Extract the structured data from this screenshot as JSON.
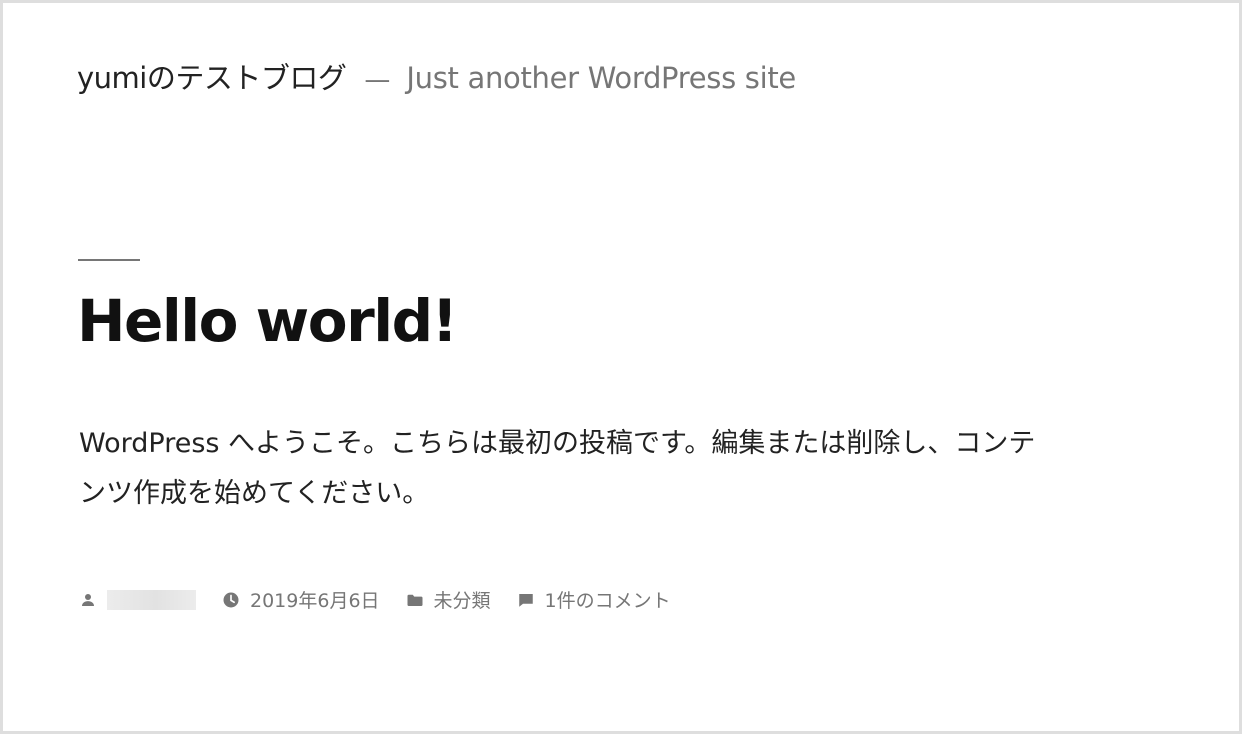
{
  "site": {
    "title": "yumiのテストブログ",
    "separator": "—",
    "description": "Just another WordPress site"
  },
  "post": {
    "title": "Hello world!",
    "content": "WordPress へようこそ。こちらは最初の投稿です。編集または削除し、コンテンツ作成を始めてください。"
  },
  "meta": {
    "author_icon": "person-icon",
    "date_icon": "clock-icon",
    "date": "2019年6月6日",
    "category_icon": "folder-icon",
    "category": "未分類",
    "comments_icon": "comment-icon",
    "comments": "1件のコメント"
  },
  "colors": {
    "text": "#222222",
    "muted": "#767676",
    "border": "#dedede"
  }
}
